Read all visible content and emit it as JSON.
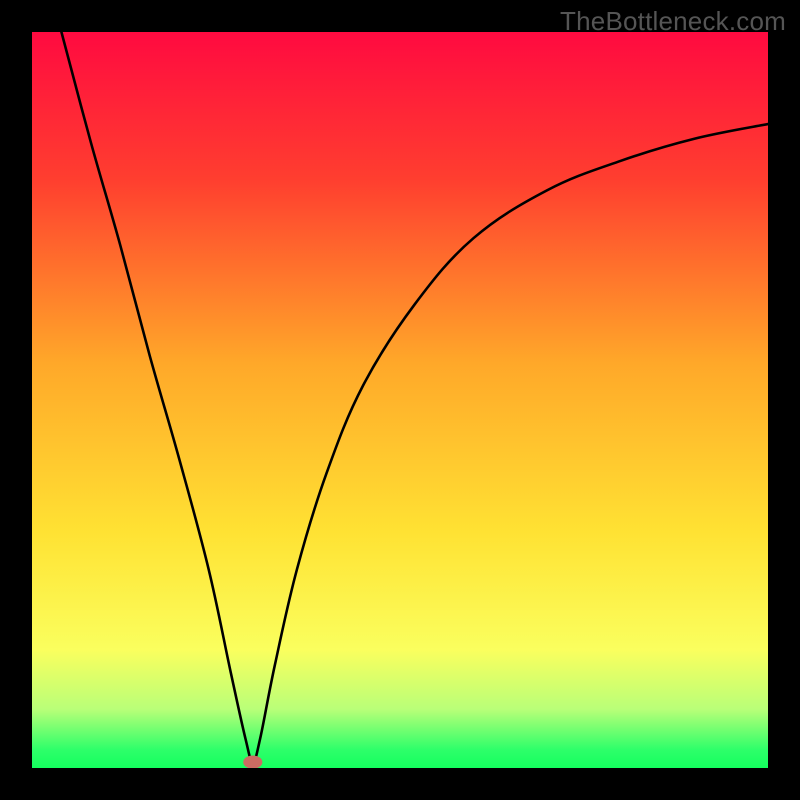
{
  "watermark": "TheBottleneck.com",
  "chart_data": {
    "type": "line",
    "title": "",
    "xlabel": "",
    "ylabel": "",
    "xlim": [
      0,
      100
    ],
    "ylim": [
      0,
      100
    ],
    "gradient_stops": [
      {
        "offset": 0,
        "color": "#ff0a40"
      },
      {
        "offset": 20,
        "color": "#ff3e2f"
      },
      {
        "offset": 45,
        "color": "#ffa829"
      },
      {
        "offset": 68,
        "color": "#ffe233"
      },
      {
        "offset": 84,
        "color": "#faff5e"
      },
      {
        "offset": 92,
        "color": "#b9ff78"
      },
      {
        "offset": 97.5,
        "color": "#2eff6a"
      },
      {
        "offset": 100,
        "color": "#14ff5e"
      }
    ],
    "curve": {
      "minimum_x": 30,
      "points": [
        {
          "x": 4,
          "y": 100
        },
        {
          "x": 8,
          "y": 85
        },
        {
          "x": 12,
          "y": 71
        },
        {
          "x": 16,
          "y": 56
        },
        {
          "x": 20,
          "y": 42
        },
        {
          "x": 24,
          "y": 27
        },
        {
          "x": 27,
          "y": 13
        },
        {
          "x": 29,
          "y": 4
        },
        {
          "x": 30,
          "y": 0.8
        },
        {
          "x": 31,
          "y": 4
        },
        {
          "x": 33,
          "y": 14
        },
        {
          "x": 36,
          "y": 27
        },
        {
          "x": 40,
          "y": 40
        },
        {
          "x": 45,
          "y": 52
        },
        {
          "x": 52,
          "y": 63
        },
        {
          "x": 60,
          "y": 72
        },
        {
          "x": 70,
          "y": 78.5
        },
        {
          "x": 80,
          "y": 82.5
        },
        {
          "x": 90,
          "y": 85.5
        },
        {
          "x": 100,
          "y": 87.5
        }
      ]
    },
    "marker": {
      "x": 30,
      "y": 0.8,
      "rx": 1.3,
      "ry": 0.9,
      "color": "#cb6b62"
    }
  }
}
